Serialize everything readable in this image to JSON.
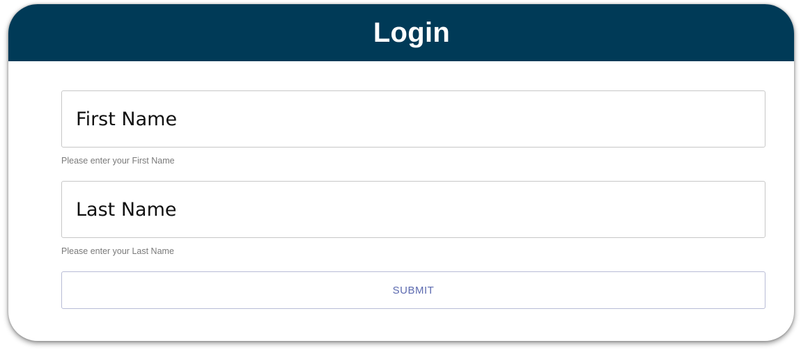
{
  "header": {
    "title": "Login",
    "background_color": "#003a57"
  },
  "form": {
    "first_name": {
      "placeholder": "First Name",
      "value": "",
      "helper": "Please enter your First Name"
    },
    "last_name": {
      "placeholder": "Last Name",
      "value": "",
      "helper": "Please enter your Last Name"
    },
    "submit_label": "SUBMIT",
    "submit_color": "#5d6bb0"
  }
}
